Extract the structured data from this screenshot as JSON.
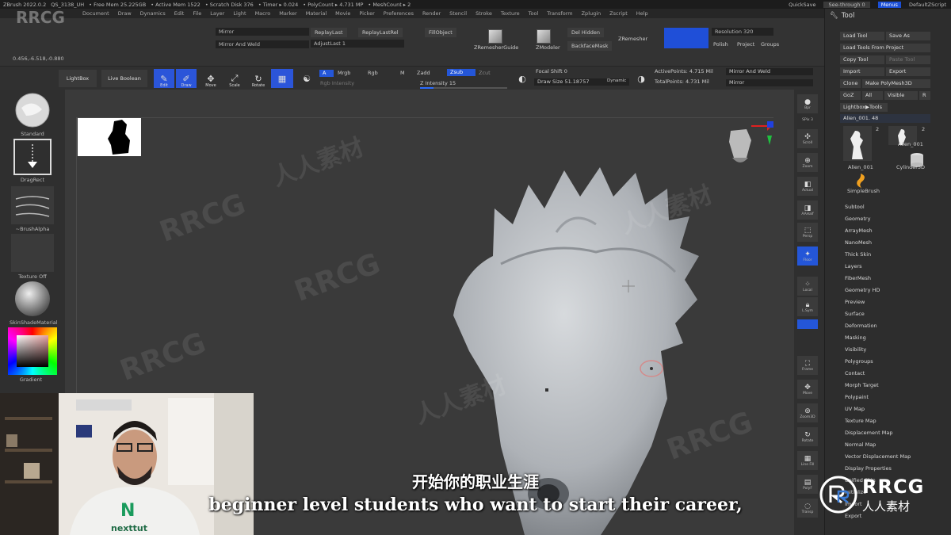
{
  "titlebar": {
    "app": "ZBrush 2022.0.2",
    "doc": "QS_3138_UH",
    "free_mem": "• Free Mem 25.225GB",
    "active_mem": "• Active Mem 1522",
    "scratch_disk": "• Scratch Disk 376",
    "timer": "• Timer ▸ 0.024",
    "polycount": "• PolyCount ▸ 4.731 MP",
    "meshcount": "• MeshCount ▸ 2",
    "quicksave": "QuickSave",
    "see_through": "See-through   0",
    "menus_btn": "Menus",
    "default_script": "DefaultZScript"
  },
  "menubar": [
    "Document",
    "Draw",
    "Dynamics",
    "Edit",
    "File",
    "Layer",
    "Light",
    "Macro",
    "Marker",
    "Material",
    "Movie",
    "Picker",
    "Preferences",
    "Render",
    "Stencil",
    "Stroke",
    "Texture",
    "Tool",
    "Transform",
    "Zplugin",
    "Zscript",
    "Help"
  ],
  "top_palette": {
    "mirror": "Mirror",
    "mirror_and_weld": "Mirror And Weld",
    "replay_last": "ReplayLast",
    "replay_last_rel": "ReplayLastRel",
    "adjust_last": "AdjustLast 1",
    "fill_object": "FillObject",
    "zremesher_guide": "ZRemesherGuide",
    "zmodeler": "ZModeler",
    "del_hidden": "Del Hidden",
    "backface_mask": "BackfaceMask",
    "zremesher": "ZRemesher",
    "resolution": "Resolution 320",
    "polish": "Polish",
    "project": "Project",
    "groups": "Groups",
    "coords": "0.456,-6.518,-0.880"
  },
  "shelf": {
    "lightbox": "LightBox",
    "live_boolean": "Live Boolean",
    "edit": "Edit",
    "draw": "Draw",
    "move": "Move",
    "scale": "Scale",
    "rotate": "Rotate",
    "a": "A",
    "mrgb": "Mrgb",
    "rgb": "Rgb",
    "m": "M",
    "zadd": "Zadd",
    "zsub": "Zsub",
    "zcut": "Zcut",
    "rgb_intensity": "Rgb Intensity",
    "z_intensity": "Z Intensity 15",
    "focal_shift": "Focal Shift 0",
    "draw_size": "Draw Size 51.18757",
    "dynamic": "Dynamic",
    "active_points": "ActivePoints: 4.715 Mil",
    "total_points": "TotalPoints: 4.731 Mil",
    "mirror_and_weld": "Mirror And Weld",
    "mirror": "Mirror"
  },
  "left_tray": {
    "brush": "Standard",
    "stroke": "DragRect",
    "alpha": "~BrushAlpha",
    "texture": "Texture Off",
    "material": "SkinShadeMaterial",
    "gradient": "Gradient"
  },
  "right_shelf": [
    "Bpr",
    "SPix 3",
    "Scroll",
    "Zoom",
    "Actual",
    "AAHalf",
    "Persp",
    "Floor",
    "Local",
    "L.Sym",
    "Frame",
    "Move",
    "Zoom3D",
    "Rotate",
    "Line Fill",
    "PolyF",
    "Transp",
    "Ghost",
    "Solo",
    "Xpose"
  ],
  "tool_palette": {
    "title": "Tool",
    "load_tool": "Load Tool",
    "save_as": "Save As",
    "load_tools_from_project": "Load Tools From Project",
    "copy_tool": "Copy Tool",
    "paste_tool": "Paste Tool",
    "import": "Import",
    "export": "Export",
    "clone": "Clone",
    "make_polymesh3d": "Make PolyMesh3D",
    "goz": "GoZ",
    "all": "All",
    "visible": "Visible",
    "r": "R",
    "lightbox_tools": "Lightbox▶Tools",
    "current_tool": "Alien_001. 48",
    "tool_count_1": "2",
    "tool_count_2": "2",
    "thumb1": "Alien_001",
    "thumb2": "Alien_001",
    "thumb3": "Cylinder3D",
    "thumb4": "SimpleBrush",
    "items": [
      "Subtool",
      "Geometry",
      "ArrayMesh",
      "NanoMesh",
      "Thick Skin",
      "Layers",
      "FiberMesh",
      "Geometry HD",
      "Preview",
      "Surface",
      "Deformation",
      "Masking",
      "Visibility",
      "Polygroups",
      "Contact",
      "Morph Target",
      "Polypaint",
      "UV Map",
      "Texture Map",
      "Displacement Map",
      "Normal Map",
      "Vector Displacement Map",
      "Display Properties",
      "Unified Skin",
      "Initialize",
      "Import",
      "Export"
    ]
  },
  "subtitles": {
    "cn": "开始你的职业生涯",
    "en": "beginner level students who want to start their career,"
  },
  "watermark": {
    "top_left": "RRCG",
    "logo_text": "RRCG",
    "logo_sub": "人人素材",
    "repeat_en": "RRCG",
    "repeat_cn": "人人素材"
  },
  "webcam": {
    "shirt_letter": "N",
    "shirt_word": "nexttut"
  },
  "colors": {
    "accent_blue": "#2456d8",
    "bg": "#2b2b2b",
    "canvas": "#3a3a3a"
  }
}
